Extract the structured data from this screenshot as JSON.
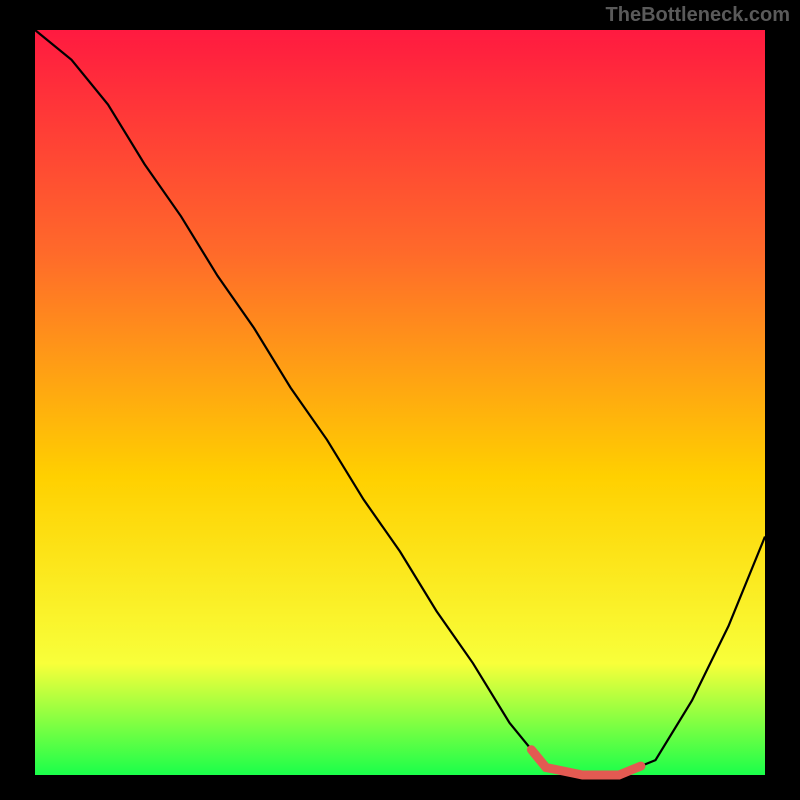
{
  "attribution": "TheBottleneck.com",
  "chart_data": {
    "type": "line",
    "title": "",
    "xlabel": "",
    "ylabel": "",
    "xlim": [
      0,
      100
    ],
    "ylim": [
      0,
      100
    ],
    "x": [
      0,
      5,
      10,
      15,
      20,
      25,
      30,
      35,
      40,
      45,
      50,
      55,
      60,
      65,
      70,
      75,
      80,
      85,
      90,
      95,
      100
    ],
    "values": [
      100,
      96,
      90,
      82,
      75,
      67,
      60,
      52,
      45,
      37,
      30,
      22,
      15,
      7,
      1,
      0,
      0,
      2,
      10,
      20,
      32
    ],
    "highlight_range_x": [
      68,
      83
    ],
    "background_gradient": {
      "top": "#ff1a40",
      "upper_mid": "#ff6a2a",
      "mid": "#ffd000",
      "lower_mid": "#f8ff3a",
      "bottom": "#1aff4a"
    },
    "frame_color": "#000000",
    "curve_color": "#000000",
    "highlight_color": "#e35a52"
  }
}
